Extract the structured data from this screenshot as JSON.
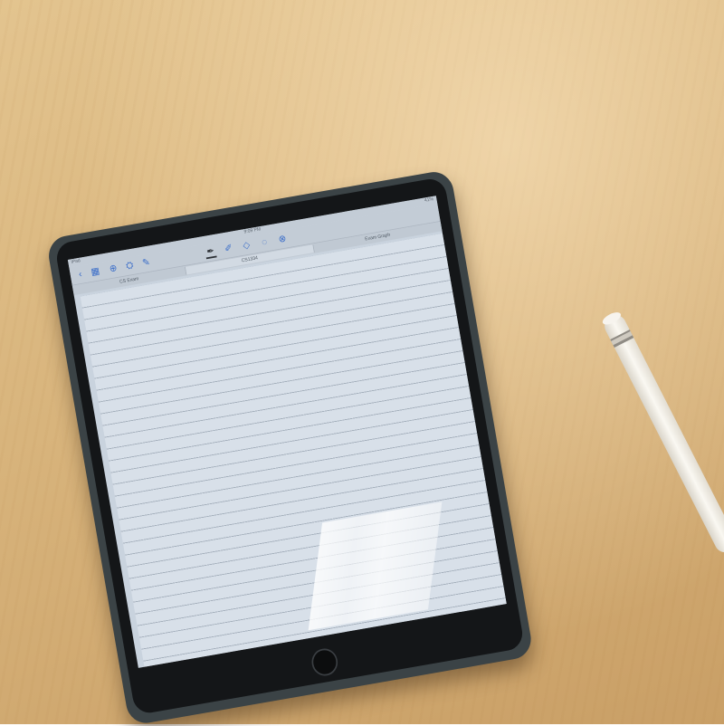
{
  "scene": {
    "surface": "light wooden desk",
    "colors": {
      "desk": "#d8b47c",
      "case": "#3b4346",
      "bezel": "#141618",
      "screen": "#c9d3de",
      "accent": "#3d6fc9",
      "pencil": "#f4f1ea"
    }
  },
  "status_bar": {
    "left": "iPad",
    "time": "9:09 PM",
    "right": "41%"
  },
  "toolbar": {
    "icons": [
      "back-icon",
      "grid-icon",
      "add-icon",
      "share-icon",
      "edit-icon",
      "pen-icon",
      "highlighter-icon",
      "eraser-icon",
      "lasso-icon",
      "more-icon"
    ]
  },
  "tabs": [
    {
      "label": "CS Exam",
      "active": false
    },
    {
      "label": "CS1334",
      "active": true
    },
    {
      "label": "Exam Graph",
      "active": false
    }
  ]
}
